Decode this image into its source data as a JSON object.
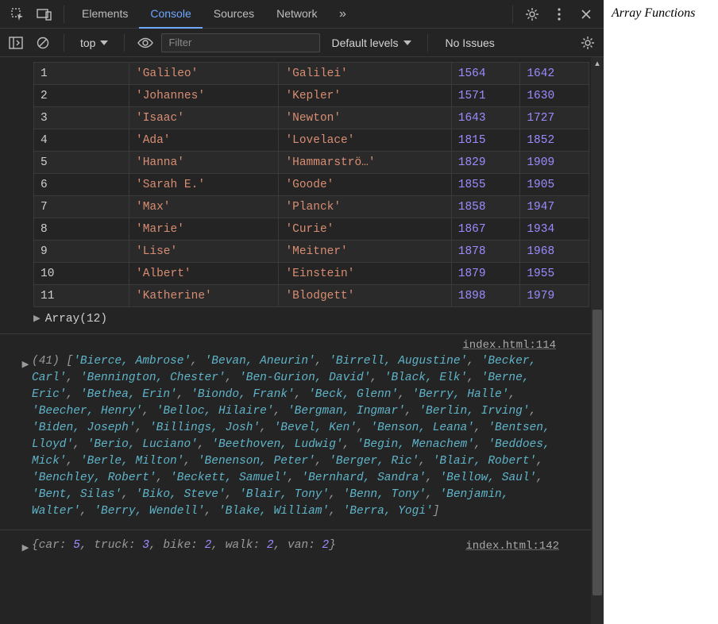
{
  "page": {
    "heading": "Array Functions"
  },
  "tabs": {
    "items": [
      "Elements",
      "Console",
      "Sources",
      "Network"
    ],
    "activeIndex": 1
  },
  "toolbar": {
    "context": "top",
    "filterPlaceholder": "Filter",
    "levels": "Default levels",
    "issues": "No Issues"
  },
  "table": {
    "rows": [
      {
        "idx": "1",
        "first": "Galileo",
        "last": "Galilei",
        "born": 1564,
        "died": 1642
      },
      {
        "idx": "2",
        "first": "Johannes",
        "last": "Kepler",
        "born": 1571,
        "died": 1630
      },
      {
        "idx": "3",
        "first": "Isaac",
        "last": "Newton",
        "born": 1643,
        "died": 1727
      },
      {
        "idx": "4",
        "first": "Ada",
        "last": "Lovelace",
        "born": 1815,
        "died": 1852
      },
      {
        "idx": "5",
        "first": "Hanna",
        "last": "Hammarströ…",
        "born": 1829,
        "died": 1909
      },
      {
        "idx": "6",
        "first": "Sarah E.",
        "last": "Goode",
        "born": 1855,
        "died": 1905
      },
      {
        "idx": "7",
        "first": "Max",
        "last": "Planck",
        "born": 1858,
        "died": 1947
      },
      {
        "idx": "8",
        "first": "Marie",
        "last": "Curie",
        "born": 1867,
        "died": 1934
      },
      {
        "idx": "9",
        "first": "Lise",
        "last": "Meitner",
        "born": 1878,
        "died": 1968
      },
      {
        "idx": "10",
        "first": "Albert",
        "last": "Einstein",
        "born": 1879,
        "died": 1955
      },
      {
        "idx": "11",
        "first": "Katherine",
        "last": "Blodgett",
        "born": 1898,
        "died": 1979
      }
    ],
    "summary": "Array(12)"
  },
  "log1": {
    "source": "index.html:114",
    "count": 41,
    "items": [
      "Bierce, Ambrose",
      "Bevan, Aneurin",
      "Birrell, Augustine",
      "Becker, Carl",
      "Bennington, Chester",
      "Ben-Gurion, David",
      "Black, Elk",
      "Berne, Eric",
      "Bethea, Erin",
      "Biondo, Frank",
      "Beck, Glenn",
      "Berry, Halle",
      "Beecher, Henry",
      "Belloc, Hilaire",
      "Bergman, Ingmar",
      "Berlin, Irving",
      "Biden, Joseph",
      "Billings, Josh",
      "Bevel, Ken",
      "Benson, Leana",
      "Bentsen, Lloyd",
      "Berio, Luciano",
      "Beethoven, Ludwig",
      "Begin, Menachem",
      "Beddoes, Mick",
      "Berle, Milton",
      "Benenson, Peter",
      "Berger, Ric",
      "Blair, Robert",
      "Benchley, Robert",
      "Beckett, Samuel",
      "Bernhard, Sandra",
      "Bellow, Saul",
      "Bent, Silas",
      "Biko, Steve",
      "Blair, Tony",
      "Benn, Tony",
      "Benjamin, Walter",
      "Berry, Wendell",
      "Blake, William",
      "Berra, Yogi"
    ]
  },
  "log2": {
    "source": "index.html:142",
    "obj": {
      "car": 5,
      "truck": 3,
      "bike": 2,
      "walk": 2,
      "van": 2
    }
  }
}
